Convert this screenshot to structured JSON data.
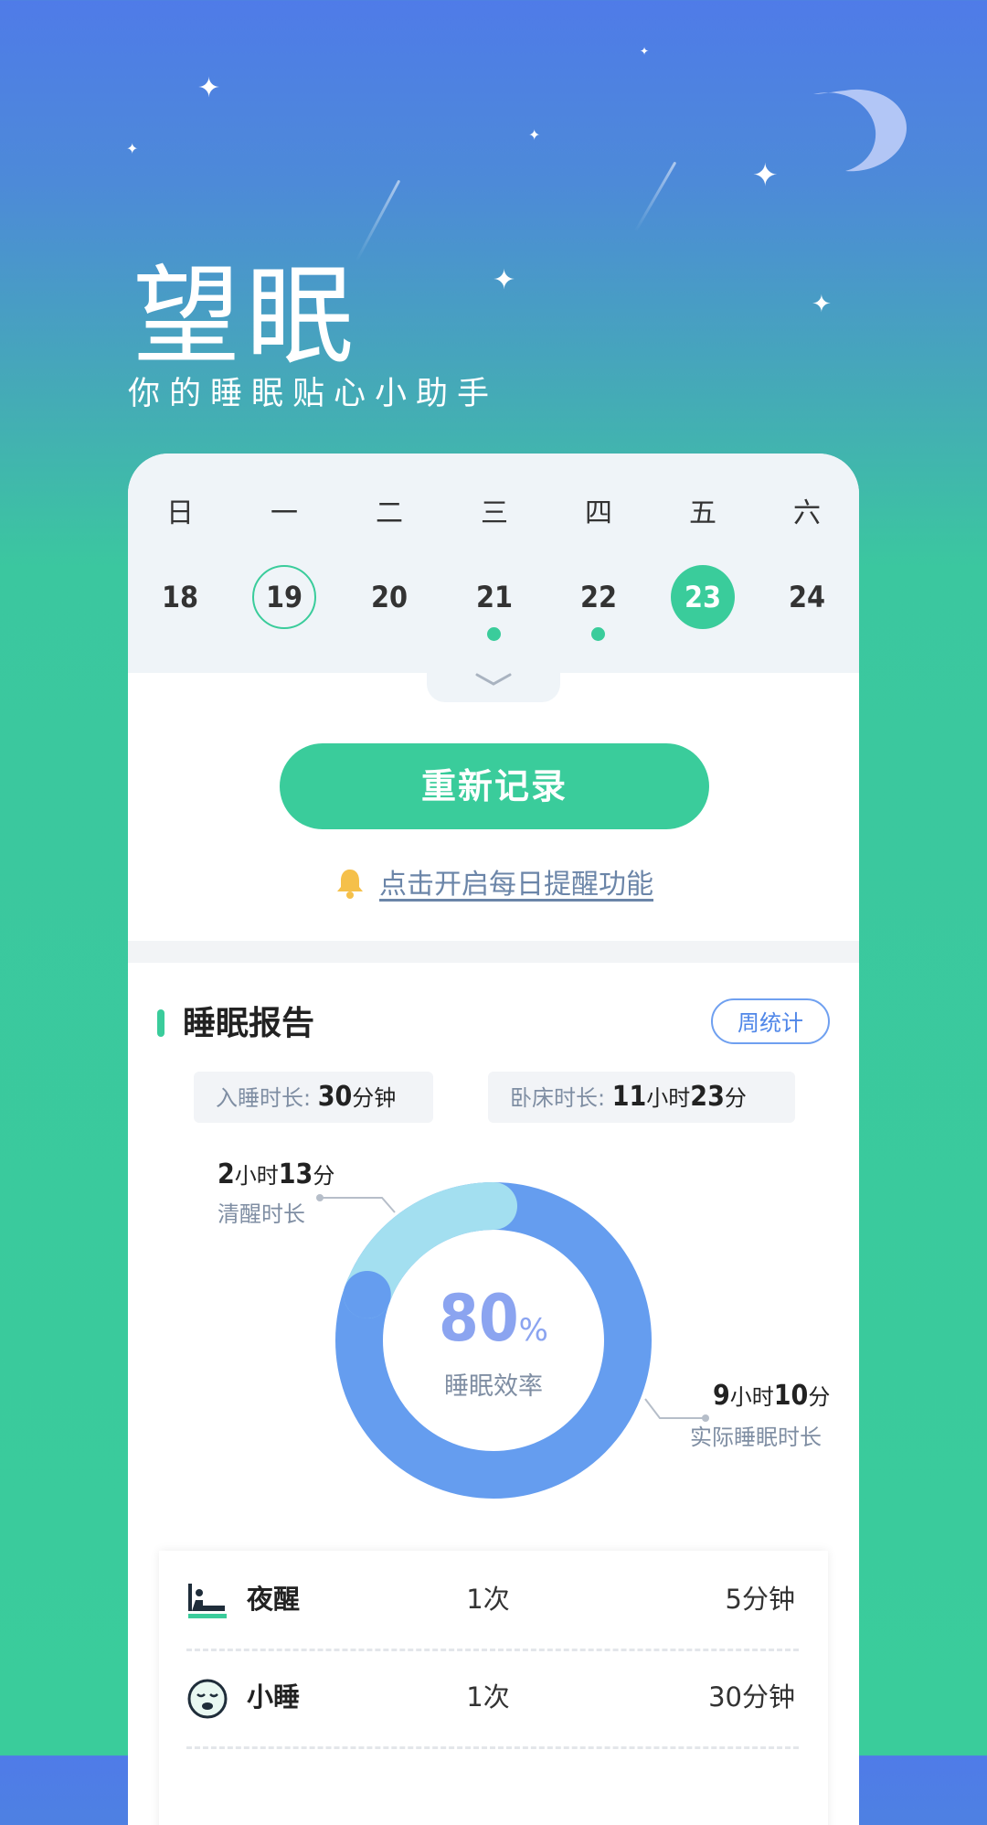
{
  "app": {
    "title": "望眠",
    "subtitle": "你的睡眠贴心小助手"
  },
  "calendar": {
    "weekdays": [
      "日",
      "一",
      "二",
      "三",
      "四",
      "五",
      "六"
    ],
    "days": [
      "18",
      "19",
      "20",
      "21",
      "22",
      "23",
      "24"
    ],
    "today_index": 1,
    "selected_index": 5,
    "recorded_indices": [
      3,
      4
    ]
  },
  "actions": {
    "record_button": "重新记录",
    "reminder_link": "点击开启每日提醒功能"
  },
  "report": {
    "title": "睡眠报告",
    "weekly_button": "周统计",
    "sleep_onset": {
      "label": "入睡时长:",
      "value": "30",
      "unit": "分钟"
    },
    "in_bed": {
      "label": "卧床时长:",
      "hours": "11",
      "hours_unit": "小时",
      "minutes": "23",
      "minutes_unit": "分"
    },
    "efficiency": {
      "value": "80",
      "unit": "%",
      "label": "睡眠效率"
    },
    "awake": {
      "hours": "2",
      "hours_unit": "小时",
      "minutes": "13",
      "minutes_unit": "分",
      "label": "清醒时长"
    },
    "actual_sleep": {
      "hours": "9",
      "hours_unit": "小时",
      "minutes": "10",
      "minutes_unit": "分",
      "label": "实际睡眠时长"
    }
  },
  "chart_data": {
    "type": "pie",
    "slices": [
      {
        "label": "清醒时长",
        "value": 133,
        "color": "#a3dff0"
      },
      {
        "label": "实际睡眠时长",
        "value": 550,
        "color": "#659def"
      }
    ]
  },
  "details": [
    {
      "icon": "night-wake-icon",
      "name": "夜醒",
      "count": "1次",
      "duration": "5分钟"
    },
    {
      "icon": "nap-icon",
      "name": "小睡",
      "count": "1次",
      "duration": "30分钟"
    }
  ],
  "colors": {
    "accent": "#3acc9b",
    "blue": "#659def",
    "light_blue": "#a3dff0",
    "bg_top": "#4f7be8"
  }
}
